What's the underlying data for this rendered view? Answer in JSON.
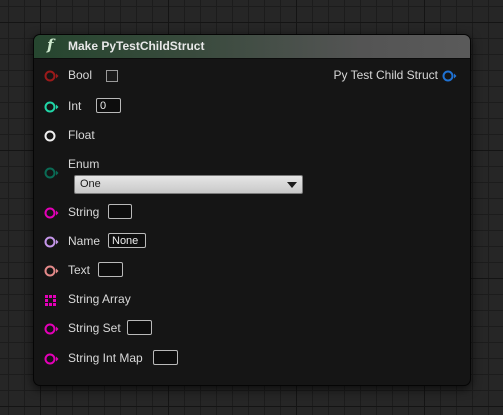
{
  "node": {
    "title": "Make PyTestChildStruct",
    "icon": "function-icon",
    "colors": {
      "bool": "#9b1a1a",
      "int": "#20d6a7",
      "float": "#f0f0f0",
      "enum": "#0a6b55",
      "string": "#e400b8",
      "name": "#c596ea",
      "text": "#e48a8a",
      "struct": "#1f72d4"
    }
  },
  "inputs": {
    "bool": {
      "label": "Bool",
      "checked": false
    },
    "int": {
      "label": "Int",
      "value": "0"
    },
    "float": {
      "label": "Float"
    },
    "enum": {
      "label": "Enum",
      "selected": "One"
    },
    "string": {
      "label": "String",
      "value": ""
    },
    "name": {
      "label": "Name",
      "value": "None"
    },
    "text": {
      "label": "Text",
      "value": ""
    },
    "string_array": {
      "label": "String Array"
    },
    "string_set": {
      "label": "String Set",
      "value": ""
    },
    "string_int_map": {
      "label": "String Int Map",
      "value": ""
    }
  },
  "outputs": {
    "struct": {
      "label": "Py Test Child Struct"
    }
  }
}
